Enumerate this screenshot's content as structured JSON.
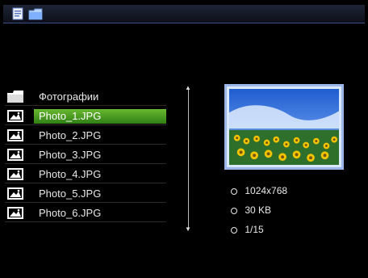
{
  "window": {
    "icons": [
      "document-icon",
      "folder-icon"
    ]
  },
  "folder": {
    "label": "Фотографии",
    "icon": "folder-icon"
  },
  "files": [
    {
      "name": "Photo_1.JPG",
      "selected": true,
      "icon": "image-icon"
    },
    {
      "name": "Photo_2.JPG",
      "selected": false,
      "icon": "image-icon"
    },
    {
      "name": "Photo_3.JPG",
      "selected": false,
      "icon": "image-icon"
    },
    {
      "name": "Photo_4.JPG",
      "selected": false,
      "icon": "image-icon"
    },
    {
      "name": "Photo_5.JPG",
      "selected": false,
      "icon": "image-icon"
    },
    {
      "name": "Photo_6.JPG",
      "selected": false,
      "icon": "image-icon"
    }
  ],
  "preview": {
    "resolution": "1024x768",
    "size": "30 KB",
    "position": "1/15"
  },
  "colors": {
    "selection": "#4c9f22",
    "preview_border": "#9bb6e9"
  }
}
